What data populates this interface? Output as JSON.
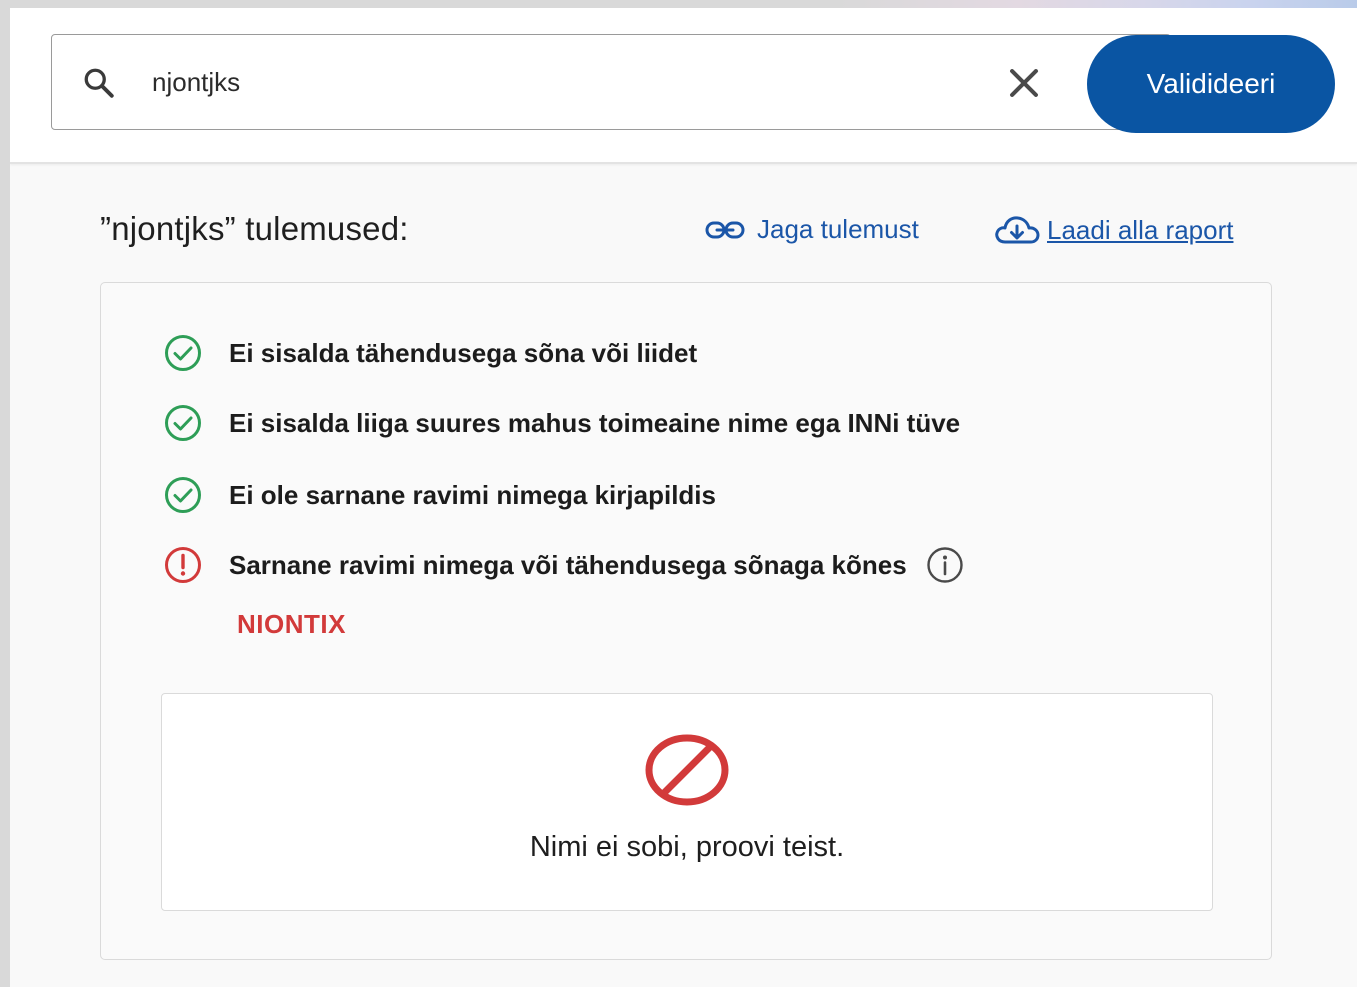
{
  "search": {
    "value": "njontjks",
    "placeholder": "",
    "search_icon": "search-icon",
    "clear_icon": "close-icon",
    "validate_label": "Validideeri"
  },
  "results": {
    "title": "”njontjks” tulemused:",
    "share_label": "Jaga tulemust",
    "share_icon": "link-icon",
    "download_label": "Laadi alla raport",
    "download_icon": "cloud-download-icon"
  },
  "checks": [
    {
      "text": "Ei sisalda tähendusega sõna või liidet",
      "status": "pass"
    },
    {
      "text": "Ei sisalda liiga suures mahus toimeaine nime ega INNi tüve",
      "status": "pass"
    },
    {
      "text": "Ei ole sarnane ravimi nimega kirjapildis",
      "status": "pass"
    },
    {
      "text": "Sarnane ravimi nimega või tähendusega sõnaga kõnes",
      "status": "fail"
    }
  ],
  "similar_name": "NIONTIX",
  "verdict": {
    "icon": "forbidden-icon",
    "text": "Nimi ei sobi, proovi teist."
  },
  "colors": {
    "primary": "#0a55a3",
    "link": "#1b56a8",
    "pass": "#2e9e57",
    "fail": "#d23a3a"
  }
}
